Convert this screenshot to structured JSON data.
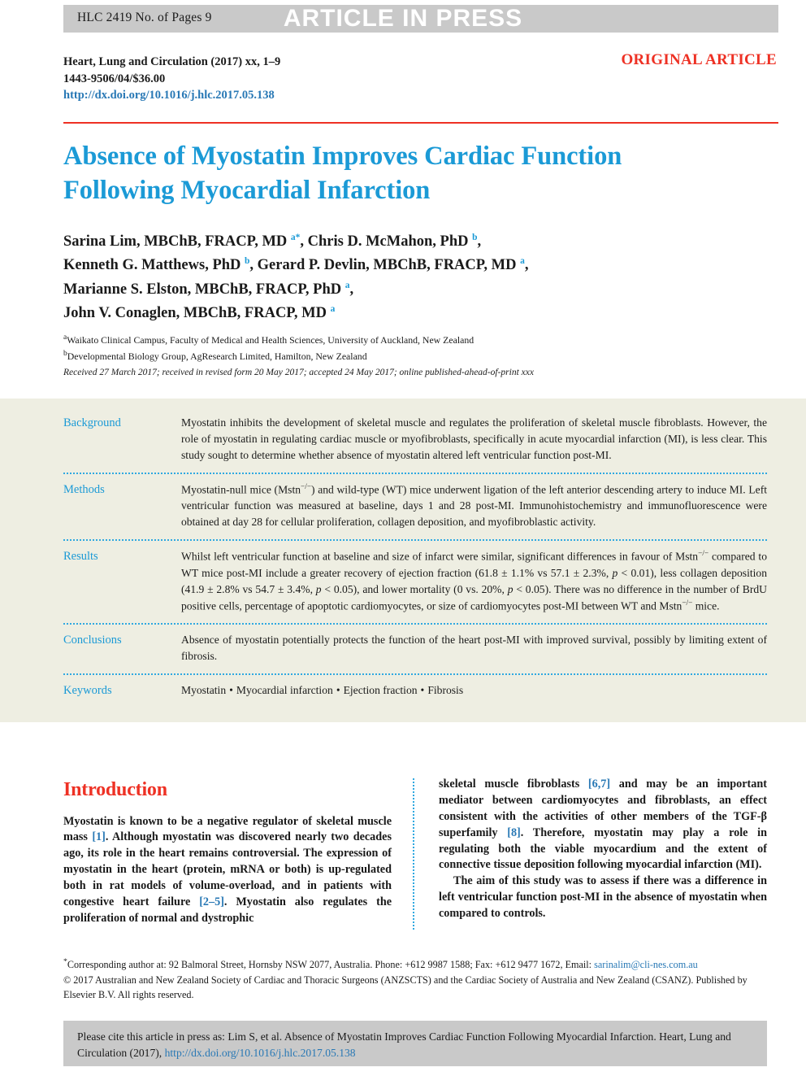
{
  "banner": {
    "id_text": "HLC 2419  No. of Pages 9",
    "press_text": "ARTICLE IN PRESS"
  },
  "journal": {
    "line1": "Heart, Lung and Circulation (2017) xx, 1–9",
    "line2": "1443-9506/04/$36.00",
    "doi": "http://dx.doi.org/10.1016/j.hlc.2017.05.138",
    "article_type": "ORIGINAL ARTICLE"
  },
  "title": "Absence of Myostatin Improves Cardiac Function Following Myocardial Infarction",
  "authors": [
    {
      "text": "Sarina Lim, MBChB, FRACP, MD ",
      "sup": "a*",
      "tail": ", Chris D. McMahon, PhD ",
      "sup2": "b",
      "tail2": ","
    },
    {
      "text": "Kenneth G. Matthews, PhD ",
      "sup": "b",
      "tail": ", Gerard P. Devlin, MBChB, FRACP, MD ",
      "sup2": "a",
      "tail2": ","
    },
    {
      "text": "Marianne S. Elston, MBChB, FRACP, PhD ",
      "sup": "a",
      "tail": ",",
      "sup2": "",
      "tail2": ""
    },
    {
      "text": "John V. Conaglen, MBChB, FRACP, MD ",
      "sup": "a",
      "tail": "",
      "sup2": "",
      "tail2": ""
    }
  ],
  "affiliations": [
    {
      "marker": "a",
      "text": "Waikato Clinical Campus, Faculty of Medical and Health Sciences, University of Auckland, New Zealand"
    },
    {
      "marker": "b",
      "text": "Developmental Biology Group, AgResearch Limited, Hamilton, New Zealand"
    }
  ],
  "received": "Received 27 March 2017; received in revised form 20 May 2017; accepted 24 May 2017; online published-ahead-of-print xxx",
  "abstract": {
    "background_label": "Background",
    "background_text": "Myostatin inhibits the development of skeletal muscle and regulates the proliferation of skeletal muscle fibroblasts. However, the role of myostatin in regulating cardiac muscle or myofibroblasts, specifically in acute myocardial infarction (MI), is less clear. This study sought to determine whether absence of myostatin altered left ventricular function post-MI.",
    "methods_label": "Methods",
    "methods_text_1": "Myostatin-null mice (Mstn",
    "methods_sup_1": "−/−",
    "methods_text_2": ") and wild-type (WT) mice underwent ligation of the left anterior descending artery to induce MI. Left ventricular function was measured at baseline, days 1 and 28 post-MI. Immunohistochemistry and immunofluorescence were obtained at day 28 for cellular proliferation, collagen deposition, and myofibroblastic activity.",
    "results_label": "Results",
    "results_text_1": "Whilst left ventricular function at baseline and size of infarct were similar, significant differences in favour of Mstn",
    "results_sup_1": "−/−",
    "results_text_2": " compared to WT mice post-MI include a greater recovery of ejection fraction (61.8 ± 1.1% vs 57.1 ± 2.3%, ",
    "results_p1": "p",
    "results_text_3": " < 0.01), less collagen deposition (41.9 ± 2.8% vs 54.7 ± 3.4%, ",
    "results_p2": "p",
    "results_text_4": " < 0.05), and lower mortality (0 vs. 20%, ",
    "results_p3": "p",
    "results_text_5": " < 0.05). There was no difference in the number of BrdU positive cells, percentage of apoptotic cardiomyocytes, or size of cardiomyocytes post-MI between WT and Mstn",
    "results_sup_2": "−/−",
    "results_text_6": " mice.",
    "conclusions_label": "Conclusions",
    "conclusions_text": "Absence of myostatin potentially protects the function of the heart post-MI with improved survival, possibly by limiting extent of fibrosis.",
    "keywords_label": "Keywords",
    "keywords": [
      "Myostatin",
      "Myocardial infarction",
      "Ejection fraction",
      "Fibrosis"
    ],
    "keyword_separator": "•"
  },
  "introduction": {
    "heading": "Introduction",
    "left_p1_a": "Myostatin is known to be a negative regulator of skeletal muscle mass ",
    "left_ref1": "[1]",
    "left_p1_b": ". Although myostatin was discovered nearly two decades ago, its role in the heart remains controversial. The expression of myostatin in the heart (protein, mRNA or both) is up-regulated both in rat models of volume-overload, and in patients with congestive heart failure ",
    "left_ref2": "[2–5]",
    "left_p1_c": ". Myostatin also regulates the proliferation of normal and dystrophic",
    "right_p1_a": "skeletal muscle fibroblasts ",
    "right_ref1": "[6,7]",
    "right_p1_b": " and may be an important mediator between cardiomyocytes and fibroblasts, an effect consistent with the activities of other members of the TGF-β superfamily ",
    "right_ref2": "[8]",
    "right_p1_c": ". Therefore, myostatin may play a role in regulating both the viable myocardium and the extent of connective tissue deposition following myocardial infarction (MI).",
    "right_p2": "The aim of this study was to assess if there was a difference in left ventricular function post-MI in the absence of myostatin when compared to controls."
  },
  "footnotes": {
    "corresponding_marker": "*",
    "corresponding_text": "Corresponding author at: 92 Balmoral Street, Hornsby NSW 2077, Australia. Phone: +612 9987 1588; Fax: +612 9477 1672, Email: ",
    "corresponding_email": "sarinalim@cli-nes.com.au",
    "copyright": "© 2017 Australian and New Zealand Society of Cardiac and Thoracic Surgeons (ANZSCTS) and the Cardiac Society of Australia and New Zealand (CSANZ). Published by Elsevier B.V. All rights reserved."
  },
  "citation_box": {
    "text": "Please cite this article in press as: Lim S, et al. Absence of Myostatin Improves Cardiac Function Following Myocardial Infarction. Heart, Lung and Circulation (2017), ",
    "doi": "http://dx.doi.org/10.1016/j.hlc.2017.05.138"
  },
  "colors": {
    "title_blue": "#1b9ad6",
    "accent_red": "#ee3124",
    "link_blue": "#2878b5",
    "banner_gray": "#c9c9c9",
    "abstract_bg": "#eeeee2",
    "dotted_blue": "#2fa8e0"
  }
}
